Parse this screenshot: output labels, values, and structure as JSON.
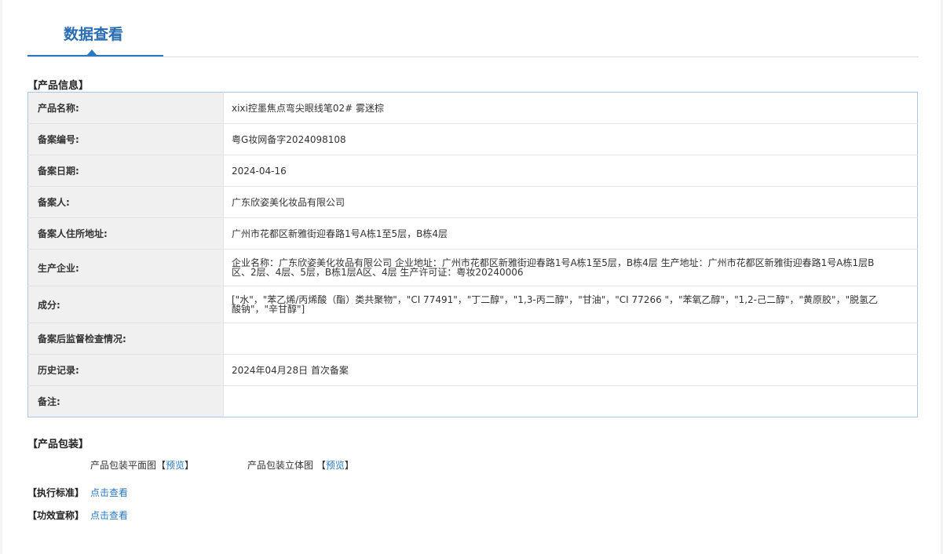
{
  "tabs": [
    {
      "label": "数据查看"
    }
  ],
  "sections": {
    "product_info": "【产品信息】",
    "packaging": "【产品包装】",
    "standard": "【执行标准】",
    "efficacy": "【功效宣称】"
  },
  "info_rows": [
    {
      "label": "产品名称:",
      "value": "xixi控墨焦点弯尖眼线笔02# 雾迷棕"
    },
    {
      "label": "备案编号:",
      "value": "粤G妆网备字2024098108"
    },
    {
      "label": "备案日期:",
      "value": "2024-04-16"
    },
    {
      "label": "备案人:",
      "value": "广东欣姿美化妆品有限公司"
    },
    {
      "label": "备案人住所地址:",
      "value": "广州市花都区新雅街迎春路1号A栋1至5层，B栋4层"
    },
    {
      "label": "生产企业:",
      "value": "企业名称：广东欣姿美化妆品有限公司 企业地址：广州市花都区新雅街迎春路1号A栋1至5层，B栋4层 生产地址：广州市花都区新雅街迎春路1号A栋1层B区、2层、4层、5层，B栋1层A区、4层 生产许可证：粤妆20240006"
    },
    {
      "label": "成分:",
      "value": "[\"水\"，\"苯乙烯/丙烯酸（酯）类共聚物\"，\"CI 77491\"，\"丁二醇\"，\"1,3-丙二醇\"，\"甘油\"，\"CI 77266 \"，\"苯氧乙醇\"，\"1,2-己二醇\"，\"黄原胶\"，\"脱氢乙酸钠\"，\"辛甘醇\"]"
    },
    {
      "label": "备案后监督检查情况:",
      "value": ""
    },
    {
      "label": "历史记录:",
      "value": "2024年04月28日 首次备案"
    },
    {
      "label": "备注:",
      "value": ""
    }
  ],
  "packaging": {
    "flat_label": "产品包装平面图",
    "solid_label": "产品包装立体图",
    "preview_link": "预览",
    "bracket_open": "【",
    "bracket_close": "】"
  },
  "links": {
    "standard_link": "点击查看",
    "efficacy_link": "点击查看"
  },
  "colors": {
    "accent": "#2a78c0",
    "title": "#2a6cb0",
    "table_border": "#a9c6e4",
    "label_bg": "#f0f0f0"
  }
}
